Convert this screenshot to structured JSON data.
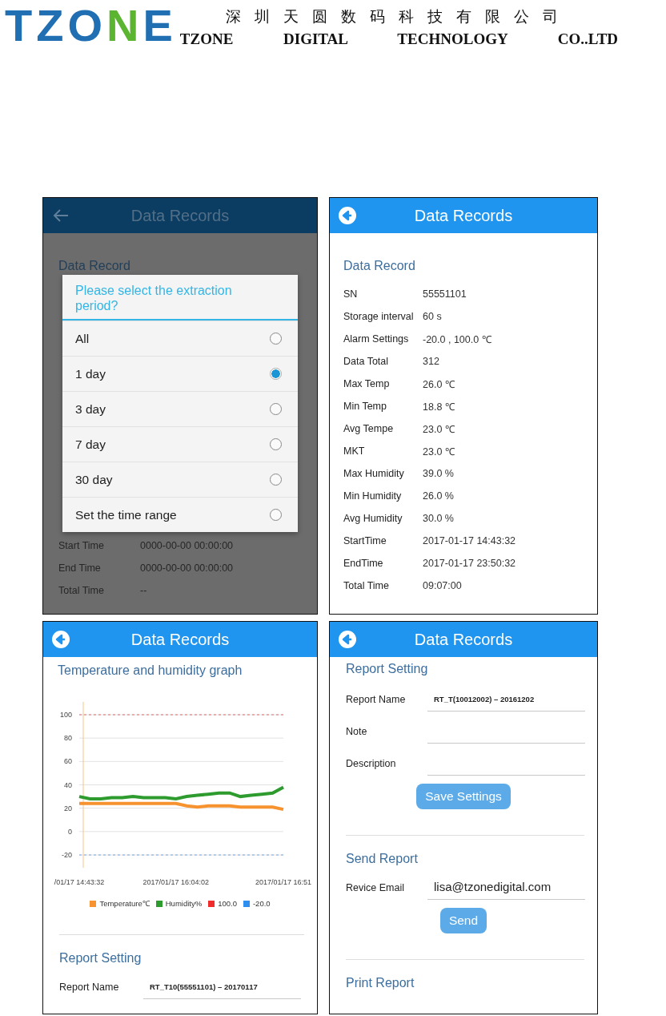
{
  "header": {
    "logo": [
      {
        "text": "TZO",
        "color": "#1f6fb2"
      },
      {
        "text": "N",
        "color": "#5bb531"
      },
      {
        "text": "E",
        "color": "#1f6fb2"
      }
    ],
    "company_cn": "深圳天圆数码科技有限公司",
    "company_en": "TZONE DIGITAL TECHNOLOGY CO..LTD"
  },
  "screens": [
    {
      "kind": "period_dialog",
      "title": "Data Records",
      "section": "Data Record",
      "rows": [
        {
          "label": "Start Time",
          "value": "0000-00-00 00:00:00"
        },
        {
          "label": "End Time",
          "value": "0000-00-00 00:00:00"
        },
        {
          "label": "Total Time",
          "value": "--"
        }
      ],
      "dialog": {
        "title": "Please select the extraction period?",
        "options": [
          {
            "label": "All",
            "selected": false
          },
          {
            "label": "1 day",
            "selected": true
          },
          {
            "label": "3 day",
            "selected": false
          },
          {
            "label": "7 day",
            "selected": false
          },
          {
            "label": "30 day",
            "selected": false
          },
          {
            "label": "Set the time range",
            "selected": false
          }
        ]
      }
    },
    {
      "kind": "summary",
      "title": "Data Records",
      "section": "Data Record",
      "rows": [
        {
          "label": "SN",
          "value": "55551101"
        },
        {
          "label": "Storage interval",
          "value": "60 s"
        },
        {
          "label": "Alarm Settings",
          "value": "-20.0 , 100.0 ℃"
        },
        {
          "label": "Data Total",
          "value": "312"
        },
        {
          "label": "Max Temp",
          "value": "26.0 ℃"
        },
        {
          "label": "Min Temp",
          "value": "18.8 ℃"
        },
        {
          "label": "Avg Tempe",
          "value": "23.0 ℃"
        },
        {
          "label": "MKT",
          "value": "23.0 ℃"
        },
        {
          "label": "Max Humidity",
          "value": "39.0 %"
        },
        {
          "label": "Min Humidity",
          "value": "26.0 %"
        },
        {
          "label": "Avg Humidity",
          "value": "30.0 %"
        },
        {
          "label": "StartTime",
          "value": "2017-01-17 14:43:32"
        },
        {
          "label": "EndTime",
          "value": "2017-01-17 23:50:32"
        },
        {
          "label": "Total Time",
          "value": "09:07:00"
        }
      ]
    },
    {
      "kind": "graph",
      "title": "Data Records",
      "section": "Temperature and humidity graph",
      "chart_data": {
        "type": "line",
        "categories": [
          "/01/17 14:43:32",
          null,
          null,
          null,
          null,
          null,
          null,
          null,
          null,
          "2017/01/17 16:04:02",
          null,
          null,
          null,
          null,
          null,
          null,
          null,
          null,
          null,
          "2017/01/17 16:51"
        ],
        "ylim": [
          -20,
          100
        ],
        "grid": true,
        "yticks": [
          -20,
          0,
          20,
          40,
          60,
          80,
          100
        ],
        "series": [
          {
            "name": "Temperature℃",
            "color": "#f7932f",
            "line_style": "solid",
            "values": [
              24,
              24,
              24,
              24,
              24,
              24,
              24,
              24,
              24,
              24,
              22,
              21,
              22,
              22,
              22,
              21,
              21,
              21,
              21,
              19
            ]
          },
          {
            "name": "Humidity%",
            "color": "#2e9b2e",
            "line_style": "solid",
            "values": [
              30,
              28,
              28,
              29,
              29,
              30,
              29,
              29,
              29,
              28,
              30,
              31,
              32,
              33,
              33,
              30,
              31,
              32,
              33,
              38
            ]
          },
          {
            "name": "100.0",
            "color": "#f02c2c",
            "line_style": "dashed",
            "values": [
              100,
              100,
              100,
              100,
              100,
              100,
              100,
              100,
              100,
              100,
              100,
              100,
              100,
              100,
              100,
              100,
              100,
              100,
              100,
              100
            ]
          },
          {
            "name": "-20.0",
            "color": "#2f8ff0",
            "line_style": "dashed",
            "values": [
              -20,
              -20,
              -20,
              -20,
              -20,
              -20,
              -20,
              -20,
              -20,
              -20,
              -20,
              -20,
              -20,
              -20,
              -20,
              -20,
              -20,
              -20,
              -20,
              -20
            ]
          }
        ]
      },
      "report": {
        "title": "Report Setting",
        "fields": [
          {
            "label": "Report Name",
            "value": "RT_T10(55551101) – 20170117"
          }
        ]
      }
    },
    {
      "kind": "report",
      "title": "Data Records",
      "sections": [
        {
          "title": "Report Setting",
          "fields": [
            {
              "label": "Report Name",
              "value": "RT_T(10012002) – 20161202"
            },
            {
              "label": "Note"
            },
            {
              "label": "Description"
            }
          ],
          "button": "Save Settings"
        },
        {
          "title": "Send Report",
          "fields": [
            {
              "label": "Revice Email",
              "value": "lisa@tzonedigital.com"
            }
          ],
          "button": "Send"
        },
        {
          "title": "Print Report"
        }
      ]
    }
  ]
}
